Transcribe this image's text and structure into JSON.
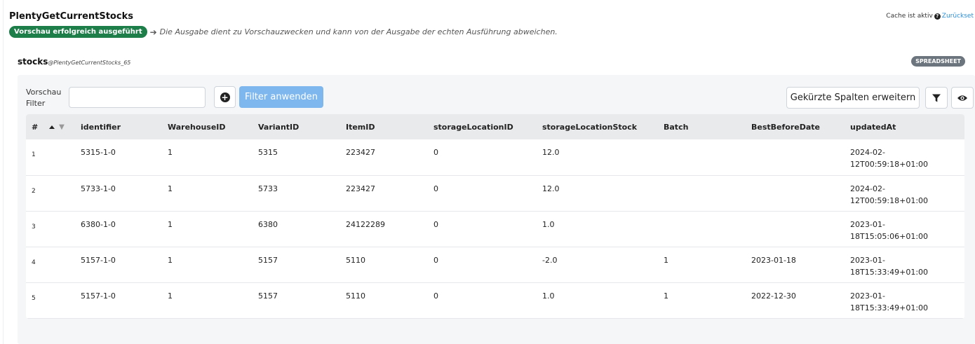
{
  "header": {
    "title": "PlentyGetCurrentStocks",
    "cache_label": "Cache ist aktiv",
    "reset_link": "Zurückset"
  },
  "status": {
    "badge": "Vorschau erfolgreich ausgeführt",
    "note": "Die Ausgabe dient zu Vorschauzwecken und kann von der Ausgabe der echten Ausführung abweichen."
  },
  "output": {
    "name": "stocks",
    "source": "@PlentyGetCurrentStocks_65",
    "view_badge": "SPREADSHEET"
  },
  "toolbar": {
    "filter_label_line1": "Vorschau",
    "filter_label_line2": "Filter",
    "filter_value": "",
    "apply_label": "Filter anwenden",
    "expand_label": "Gekürzte Spalten erweitern"
  },
  "table": {
    "columns": [
      "#",
      "identifier",
      "WarehouseID",
      "VariantID",
      "ItemID",
      "storageLocationID",
      "storageLocationStock",
      "Batch",
      "BestBeforeDate",
      "updatedAt"
    ],
    "rows": [
      {
        "num": "1",
        "identifier": "5315-1-0",
        "warehouse": "1",
        "variant": "5315",
        "item": "223427",
        "loc_id": "0",
        "loc_stock": "12.0",
        "batch": "",
        "best_before": "",
        "updated_1": "2024-02-",
        "updated_2": "12T00:59:18+01:00"
      },
      {
        "num": "2",
        "identifier": "5733-1-0",
        "warehouse": "1",
        "variant": "5733",
        "item": "223427",
        "loc_id": "0",
        "loc_stock": "12.0",
        "batch": "",
        "best_before": "",
        "updated_1": "2024-02-",
        "updated_2": "12T00:59:18+01:00"
      },
      {
        "num": "3",
        "identifier": "6380-1-0",
        "warehouse": "1",
        "variant": "6380",
        "item": "24122289",
        "loc_id": "0",
        "loc_stock": "1.0",
        "batch": "",
        "best_before": "",
        "updated_1": "2023-01-",
        "updated_2": "18T15:05:06+01:00"
      },
      {
        "num": "4",
        "identifier": "5157-1-0",
        "warehouse": "1",
        "variant": "5157",
        "item": "5110",
        "loc_id": "0",
        "loc_stock": "-2.0",
        "batch": "1",
        "best_before": "2023-01-18",
        "updated_1": "2023-01-",
        "updated_2": "18T15:33:49+01:00"
      },
      {
        "num": "5",
        "identifier": "5157-1-0",
        "warehouse": "1",
        "variant": "5157",
        "item": "5110",
        "loc_id": "0",
        "loc_stock": "1.0",
        "batch": "1",
        "best_before": "2022-12-30",
        "updated_1": "2023-01-",
        "updated_2": "18T15:33:49+01:00"
      }
    ]
  }
}
